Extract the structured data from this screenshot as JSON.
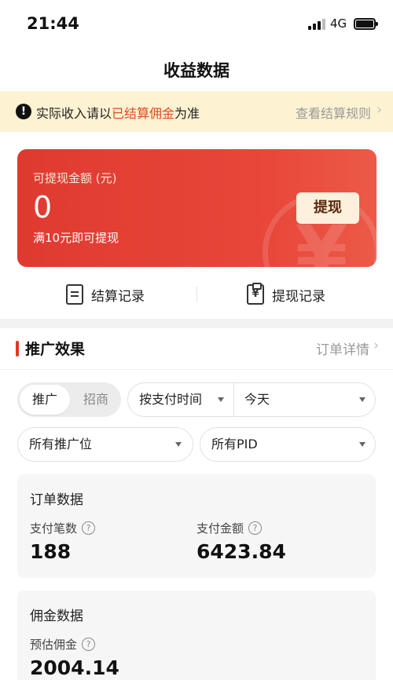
{
  "status_bar": {
    "time": "21:44",
    "network": "4G"
  },
  "header": {
    "title": "收益数据"
  },
  "notice": {
    "text_before": "实际收入请以",
    "text_highlight": "已结算佣金",
    "text_after": "为准",
    "link_label": "查看结算规则"
  },
  "balance_card": {
    "label": "可提现金额 (元)",
    "amount": "0",
    "note": "满10元即可提现",
    "withdraw_label": "提现"
  },
  "records": {
    "settlement_label": "结算记录",
    "withdraw_label": "提现记录"
  },
  "promotion": {
    "title": "推广效果",
    "detail_link": "订单详情"
  },
  "filters": {
    "toggle_active": "推广",
    "toggle_inactive": "招商",
    "time_type": "按支付时间",
    "date_range": "今天",
    "position": "所有推广位",
    "pid": "所有PID"
  },
  "order_data": {
    "title": "订单数据",
    "count_label": "支付笔数",
    "count_value": "188",
    "amount_label": "支付金额",
    "amount_value": "6423.84"
  },
  "commission_data": {
    "title": "佣金数据",
    "estimate_label": "预估佣金",
    "estimate_value": "2004.14"
  },
  "colors": {
    "accent_red": "#e03a30",
    "highlight_orange": "#e04a1f",
    "notice_bg": "#fdf3d3"
  },
  "icons": [
    "signal-icon",
    "battery-icon",
    "warning-icon",
    "chevron-right-icon",
    "document-icon",
    "clipboard-yuan-icon",
    "caret-down-icon",
    "question-icon"
  ]
}
